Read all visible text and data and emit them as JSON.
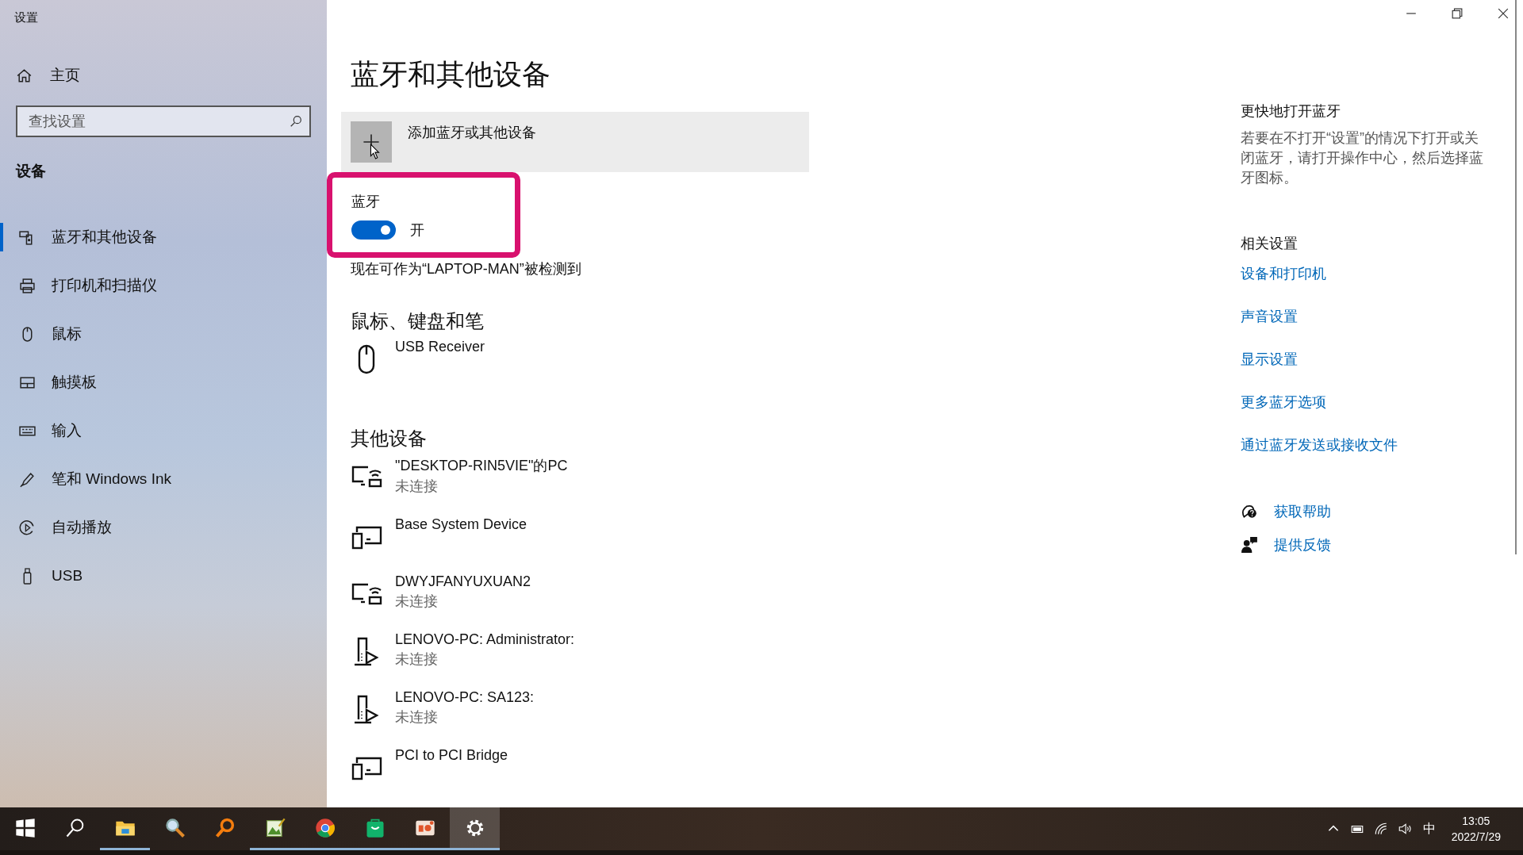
{
  "window": {
    "title": "设置"
  },
  "sidebar": {
    "home": "主页",
    "search": {
      "placeholder": "查找设置"
    },
    "section": "设备",
    "items": [
      {
        "label": "蓝牙和其他设备",
        "kind": "bluetooth",
        "selected": true
      },
      {
        "label": "打印机和扫描仪",
        "kind": "printer",
        "selected": false
      },
      {
        "label": "鼠标",
        "kind": "mouse",
        "selected": false
      },
      {
        "label": "触摸板",
        "kind": "touchpad",
        "selected": false
      },
      {
        "label": "输入",
        "kind": "keyboard",
        "selected": false
      },
      {
        "label": "笔和 Windows Ink",
        "kind": "pen",
        "selected": false
      },
      {
        "label": "自动播放",
        "kind": "autoplay",
        "selected": false
      },
      {
        "label": "USB",
        "kind": "usb",
        "selected": false
      }
    ]
  },
  "page": {
    "title": "蓝牙和其他设备",
    "add_device": "添加蓝牙或其他设备",
    "bluetooth": {
      "label": "蓝牙",
      "on": true,
      "state_text": "开",
      "highlighted": true
    },
    "discoverable": "现在可作为“LAPTOP-MAN”被检测到",
    "sections": [
      {
        "title": "鼠标、键盘和笔",
        "devices": [
          {
            "name": "USB Receiver",
            "kind": "mouse"
          }
        ]
      },
      {
        "title": "其他设备",
        "devices": [
          {
            "name": "\"DESKTOP-RIN5VIE\"的PC",
            "status": "未连接",
            "kind": "pc-wireless"
          },
          {
            "name": "Base System Device",
            "kind": "devices"
          },
          {
            "name": "DWYJFANYUXUAN2",
            "status": "未连接",
            "kind": "pc-wireless"
          },
          {
            "name": "LENOVO-PC: Administrator:",
            "status": "未连接",
            "kind": "media"
          },
          {
            "name": "LENOVO-PC: SA123:",
            "status": "未连接",
            "kind": "media"
          },
          {
            "name": "PCI to PCI Bridge",
            "kind": "devices"
          }
        ]
      }
    ]
  },
  "side_panel": {
    "quick": {
      "title": "更快地打开蓝牙",
      "text": "若要在不打开“设置”的情况下打开或关闭蓝牙，请打开操作中心，然后选择蓝牙图标。"
    },
    "related": {
      "title": "相关设置",
      "links": [
        "设备和打印机",
        "声音设置",
        "显示设置",
        "更多蓝牙选项",
        "通过蓝牙发送或接收文件"
      ]
    },
    "help": [
      {
        "label": "获取帮助",
        "kind": "help"
      },
      {
        "label": "提供反馈",
        "kind": "feedback"
      }
    ]
  },
  "taskbar": {
    "apps": [
      {
        "kind": "start",
        "running": false,
        "selected": false
      },
      {
        "kind": "search",
        "running": false,
        "selected": false
      },
      {
        "kind": "folder",
        "running": true,
        "selected": false
      },
      {
        "kind": "magnifier",
        "running": false,
        "selected": false
      },
      {
        "kind": "orange-search",
        "running": false,
        "selected": false
      },
      {
        "kind": "image-editor",
        "running": true,
        "selected": false
      },
      {
        "kind": "browser",
        "running": true,
        "selected": false
      },
      {
        "kind": "bag",
        "running": true,
        "selected": false
      },
      {
        "kind": "slides",
        "running": true,
        "selected": false
      },
      {
        "kind": "gear",
        "running": true,
        "selected": true
      }
    ],
    "tray": {
      "ime": "中",
      "time": "13:05",
      "date": "2022/7/29"
    }
  }
}
